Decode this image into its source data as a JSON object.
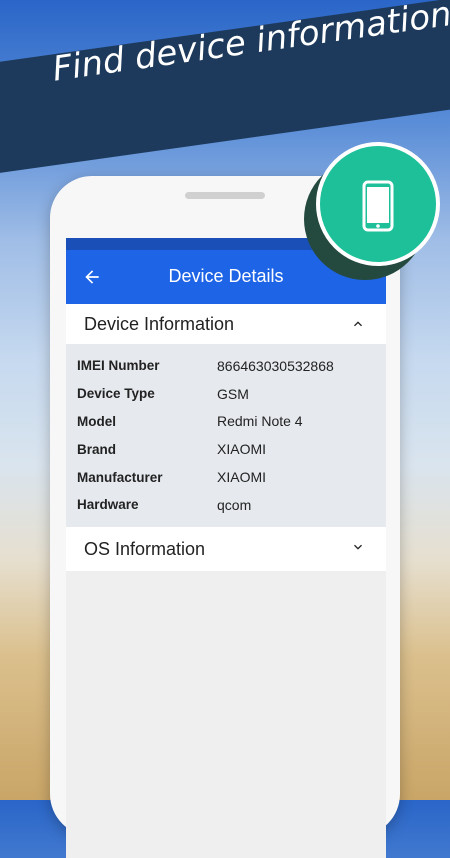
{
  "banner": {
    "title": "Find device information"
  },
  "appbar": {
    "title": "Device Details"
  },
  "device_section": {
    "title": "Device Information",
    "rows": [
      {
        "key": "IMEI Number",
        "value": "866463030532868"
      },
      {
        "key": "Device Type",
        "value": "GSM"
      },
      {
        "key": "Model",
        "value": "Redmi Note 4"
      },
      {
        "key": "Brand",
        "value": "XIAOMI"
      },
      {
        "key": "Manufacturer",
        "value": "XIAOMI"
      },
      {
        "key": "Hardware",
        "value": "qcom"
      }
    ]
  },
  "os_section": {
    "title": "OS Information"
  },
  "icons": {
    "back": "arrow-back-icon",
    "collapse": "chevron-up-icon",
    "expand": "chevron-down-icon",
    "badge": "smartphone-icon"
  },
  "colors": {
    "appbar": "#1e64e6",
    "banner": "#1d3a5c",
    "badge": "#1ec09a"
  }
}
